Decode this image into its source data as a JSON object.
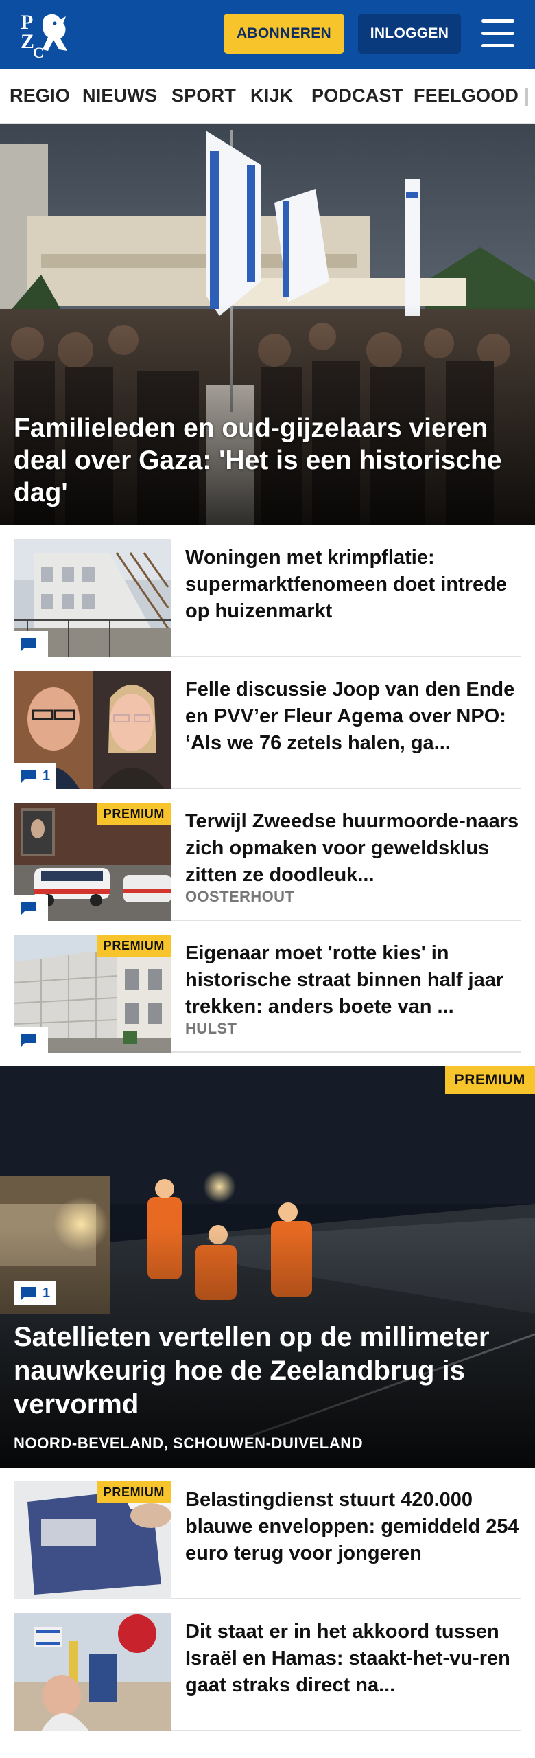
{
  "header": {
    "logo_text": "PZC",
    "subscribe_label": "ABONNEREN",
    "login_label": "INLOGGEN",
    "menu_icon": "hamburger-icon",
    "colors": {
      "brand": "#0b4ea2",
      "accent": "#f7c52b"
    }
  },
  "nav": {
    "items": [
      {
        "label": "REGIO"
      },
      {
        "label": "NIEUWS"
      },
      {
        "label": "SPORT"
      },
      {
        "label": "KIJK"
      },
      {
        "label": "PODCAST"
      },
      {
        "label": "FEELGOOD"
      }
    ]
  },
  "hero": {
    "title": "Familieleden en oud-gijzelaars vieren deal over Gaza: 'Het is een historische dag'"
  },
  "articles": [
    {
      "title": "Woningen met krimpflatie: supermarktfenomeen doet intrede op huizenmarkt",
      "comments": "",
      "premium": false,
      "location": ""
    },
    {
      "title": "Felle discussie Joop van den Ende en PVV’er Fleur Agema over NPO: ‘Als we 76 zetels halen, ga...",
      "comments": "1",
      "premium": false,
      "location": ""
    },
    {
      "title": "Terwijl Zweedse huurmoorde-naars zich opmaken voor geweldsklus zitten ze doodleuk...",
      "comments": "",
      "premium": true,
      "location": "OOSTERHOUT"
    },
    {
      "title": "Eigenaar moet 'rotte kies' in historische straat binnen half jaar trekken: anders boete van ...",
      "comments": "",
      "premium": true,
      "location": "HULST"
    }
  ],
  "feature": {
    "premium_label": "PREMIUM",
    "comments": "1",
    "title": "Satellieten vertellen op de millimeter nauwkeurig hoe de Zeelandbrug is vervormd",
    "locations": "NOORD-BEVELAND, SCHOUWEN-DUIVELAND"
  },
  "articles_more": [
    {
      "title": "Belastingdienst stuurt 420.000 blauwe enveloppen: gemiddeld 254 euro terug voor jongeren",
      "premium": true
    },
    {
      "title": "Dit staat er in het akkoord tussen Israël en Hamas: staakt-het-vu-ren gaat straks direct na...",
      "premium": false
    }
  ],
  "labels": {
    "premium": "PREMIUM"
  }
}
